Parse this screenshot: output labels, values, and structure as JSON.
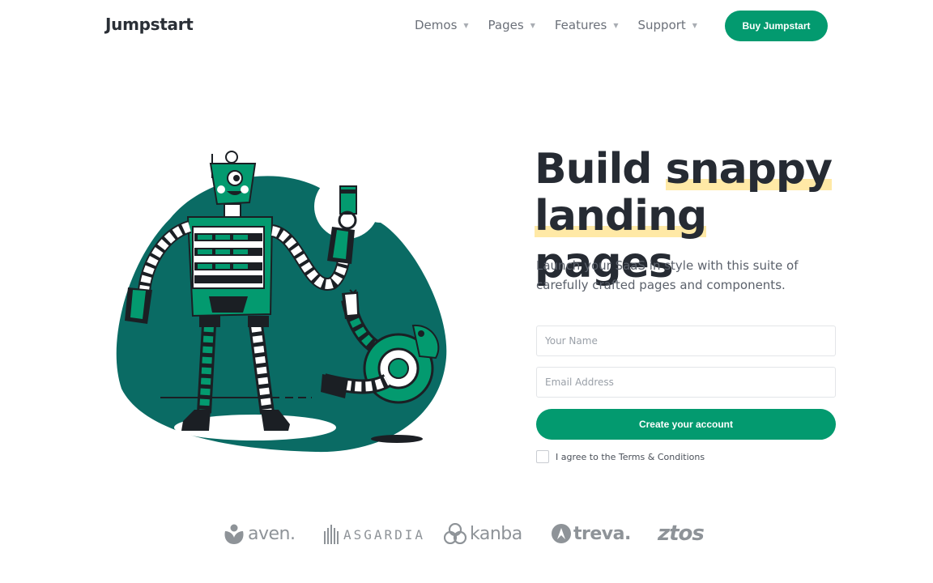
{
  "brand": {
    "name": "Jumpstart"
  },
  "nav": {
    "items": [
      {
        "label": "Demos"
      },
      {
        "label": "Pages"
      },
      {
        "label": "Features"
      },
      {
        "label": "Support"
      }
    ],
    "cta_label": "Buy Jumpstart"
  },
  "hero": {
    "title_part1": "Build ",
    "title_highlight1": "snappy",
    "title_highlight2": "landing",
    "title_part2": " pages",
    "subtitle": "Launch your SaaS in style with this suite of carefully crafted pages and components."
  },
  "form": {
    "name_placeholder": "Your Name",
    "email_placeholder": "Email Address",
    "submit_label": "Create your account",
    "agree_label": "I agree to the Terms & Conditions"
  },
  "logos": [
    {
      "name": "aven."
    },
    {
      "name": "ASGARDIA"
    },
    {
      "name": "kanba"
    },
    {
      "name": "treva."
    },
    {
      "name": "ztos"
    }
  ],
  "colors": {
    "brand_green": "#039a6f",
    "dark_teal": "#0a6b64",
    "highlight": "#ffe9a6",
    "text_dark": "#262b33"
  }
}
